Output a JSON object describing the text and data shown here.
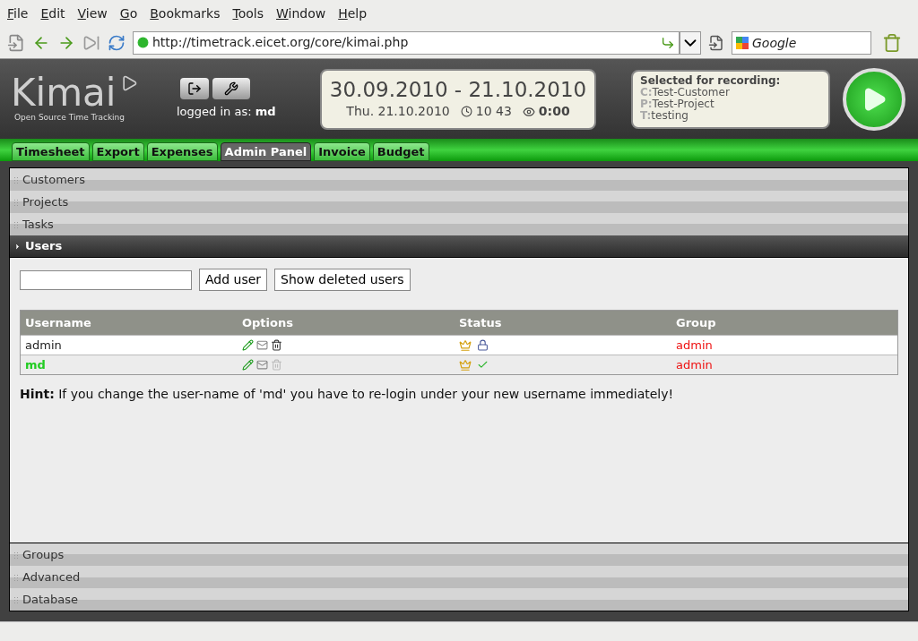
{
  "menu": [
    "File",
    "Edit",
    "View",
    "Go",
    "Bookmarks",
    "Tools",
    "Window",
    "Help"
  ],
  "toolbar": {
    "url": "http://timetrack.eicet.org/core/kimai.php",
    "search_placeholder": "Google"
  },
  "header": {
    "logo": "Kimai",
    "tagline": "Open Source Time Tracking",
    "logged_in_label": "logged in as:",
    "user": "md",
    "date_range": "30.09.2010 - 21.10.2010",
    "date": "Thu. 21.10.2010",
    "time": "10 43",
    "duration": "0:00",
    "recording": {
      "title": "Selected for recording:",
      "lines": [
        {
          "prefix": "C:",
          "value": "Test-Customer"
        },
        {
          "prefix": "P:",
          "value": "Test-Project"
        },
        {
          "prefix": "T:",
          "value": "testing"
        }
      ]
    }
  },
  "tabs": [
    {
      "label": "Timesheet",
      "selected": false
    },
    {
      "label": "Export",
      "selected": false
    },
    {
      "label": "Expenses",
      "selected": false
    },
    {
      "label": "Admin Panel",
      "selected": true
    },
    {
      "label": "Invoice",
      "selected": false
    },
    {
      "label": "Budget",
      "selected": false
    }
  ],
  "sections": [
    {
      "label": "Customers",
      "expanded": false
    },
    {
      "label": "Projects",
      "expanded": false
    },
    {
      "label": "Tasks",
      "expanded": false
    },
    {
      "label": "Users",
      "expanded": true
    },
    {
      "label": "Groups",
      "expanded": false
    },
    {
      "label": "Advanced",
      "expanded": false
    },
    {
      "label": "Database",
      "expanded": false
    }
  ],
  "users_panel": {
    "buttons": [
      "Add user",
      "Show deleted users"
    ],
    "columns": [
      "Username",
      "Options",
      "Status",
      "Group"
    ],
    "rows": [
      {
        "username": "admin",
        "current": false,
        "can_delete": true,
        "kind": "locked",
        "group": "admin"
      },
      {
        "username": "md",
        "current": true,
        "can_delete": false,
        "kind": "active",
        "group": "admin"
      }
    ],
    "hint": {
      "label": "Hint:",
      "text": "If you change the user-name of 'md' you have to re-login under your new username immediately!"
    }
  }
}
